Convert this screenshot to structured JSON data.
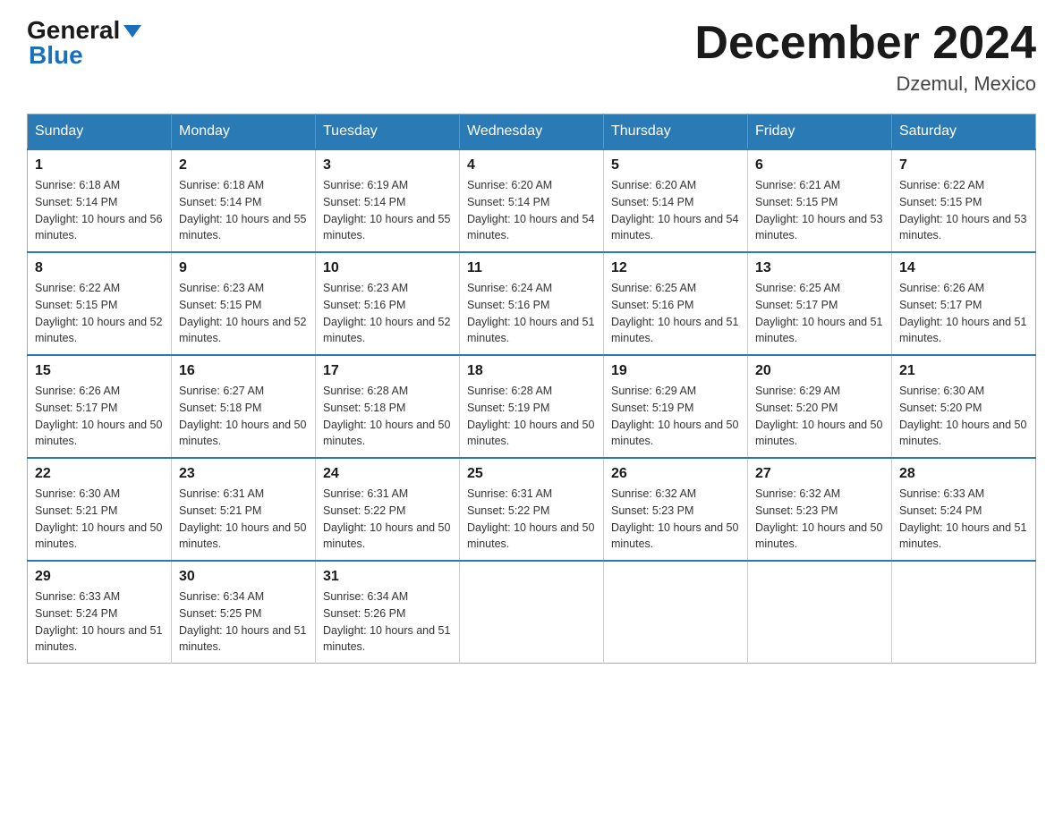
{
  "header": {
    "logo_general": "General",
    "logo_blue": "Blue",
    "title": "December 2024",
    "subtitle": "Dzemul, Mexico"
  },
  "weekdays": [
    "Sunday",
    "Monday",
    "Tuesday",
    "Wednesday",
    "Thursday",
    "Friday",
    "Saturday"
  ],
  "weeks": [
    [
      {
        "day": "1",
        "sunrise": "6:18 AM",
        "sunset": "5:14 PM",
        "daylight": "10 hours and 56 minutes."
      },
      {
        "day": "2",
        "sunrise": "6:18 AM",
        "sunset": "5:14 PM",
        "daylight": "10 hours and 55 minutes."
      },
      {
        "day": "3",
        "sunrise": "6:19 AM",
        "sunset": "5:14 PM",
        "daylight": "10 hours and 55 minutes."
      },
      {
        "day": "4",
        "sunrise": "6:20 AM",
        "sunset": "5:14 PM",
        "daylight": "10 hours and 54 minutes."
      },
      {
        "day": "5",
        "sunrise": "6:20 AM",
        "sunset": "5:14 PM",
        "daylight": "10 hours and 54 minutes."
      },
      {
        "day": "6",
        "sunrise": "6:21 AM",
        "sunset": "5:15 PM",
        "daylight": "10 hours and 53 minutes."
      },
      {
        "day": "7",
        "sunrise": "6:22 AM",
        "sunset": "5:15 PM",
        "daylight": "10 hours and 53 minutes."
      }
    ],
    [
      {
        "day": "8",
        "sunrise": "6:22 AM",
        "sunset": "5:15 PM",
        "daylight": "10 hours and 52 minutes."
      },
      {
        "day": "9",
        "sunrise": "6:23 AM",
        "sunset": "5:15 PM",
        "daylight": "10 hours and 52 minutes."
      },
      {
        "day": "10",
        "sunrise": "6:23 AM",
        "sunset": "5:16 PM",
        "daylight": "10 hours and 52 minutes."
      },
      {
        "day": "11",
        "sunrise": "6:24 AM",
        "sunset": "5:16 PM",
        "daylight": "10 hours and 51 minutes."
      },
      {
        "day": "12",
        "sunrise": "6:25 AM",
        "sunset": "5:16 PM",
        "daylight": "10 hours and 51 minutes."
      },
      {
        "day": "13",
        "sunrise": "6:25 AM",
        "sunset": "5:17 PM",
        "daylight": "10 hours and 51 minutes."
      },
      {
        "day": "14",
        "sunrise": "6:26 AM",
        "sunset": "5:17 PM",
        "daylight": "10 hours and 51 minutes."
      }
    ],
    [
      {
        "day": "15",
        "sunrise": "6:26 AM",
        "sunset": "5:17 PM",
        "daylight": "10 hours and 50 minutes."
      },
      {
        "day": "16",
        "sunrise": "6:27 AM",
        "sunset": "5:18 PM",
        "daylight": "10 hours and 50 minutes."
      },
      {
        "day": "17",
        "sunrise": "6:28 AM",
        "sunset": "5:18 PM",
        "daylight": "10 hours and 50 minutes."
      },
      {
        "day": "18",
        "sunrise": "6:28 AM",
        "sunset": "5:19 PM",
        "daylight": "10 hours and 50 minutes."
      },
      {
        "day": "19",
        "sunrise": "6:29 AM",
        "sunset": "5:19 PM",
        "daylight": "10 hours and 50 minutes."
      },
      {
        "day": "20",
        "sunrise": "6:29 AM",
        "sunset": "5:20 PM",
        "daylight": "10 hours and 50 minutes."
      },
      {
        "day": "21",
        "sunrise": "6:30 AM",
        "sunset": "5:20 PM",
        "daylight": "10 hours and 50 minutes."
      }
    ],
    [
      {
        "day": "22",
        "sunrise": "6:30 AM",
        "sunset": "5:21 PM",
        "daylight": "10 hours and 50 minutes."
      },
      {
        "day": "23",
        "sunrise": "6:31 AM",
        "sunset": "5:21 PM",
        "daylight": "10 hours and 50 minutes."
      },
      {
        "day": "24",
        "sunrise": "6:31 AM",
        "sunset": "5:22 PM",
        "daylight": "10 hours and 50 minutes."
      },
      {
        "day": "25",
        "sunrise": "6:31 AM",
        "sunset": "5:22 PM",
        "daylight": "10 hours and 50 minutes."
      },
      {
        "day": "26",
        "sunrise": "6:32 AM",
        "sunset": "5:23 PM",
        "daylight": "10 hours and 50 minutes."
      },
      {
        "day": "27",
        "sunrise": "6:32 AM",
        "sunset": "5:23 PM",
        "daylight": "10 hours and 50 minutes."
      },
      {
        "day": "28",
        "sunrise": "6:33 AM",
        "sunset": "5:24 PM",
        "daylight": "10 hours and 51 minutes."
      }
    ],
    [
      {
        "day": "29",
        "sunrise": "6:33 AM",
        "sunset": "5:24 PM",
        "daylight": "10 hours and 51 minutes."
      },
      {
        "day": "30",
        "sunrise": "6:34 AM",
        "sunset": "5:25 PM",
        "daylight": "10 hours and 51 minutes."
      },
      {
        "day": "31",
        "sunrise": "6:34 AM",
        "sunset": "5:26 PM",
        "daylight": "10 hours and 51 minutes."
      },
      null,
      null,
      null,
      null
    ]
  ]
}
